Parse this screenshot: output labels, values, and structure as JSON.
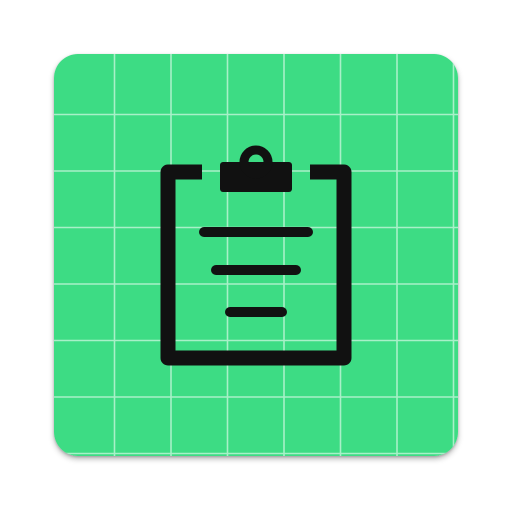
{
  "app_icon": {
    "icon": "clipboard-icon",
    "background_pattern": "grid",
    "colors": {
      "background": "#3ddc84",
      "grid_lines": "#a8f0c8",
      "glyph": "#111111"
    }
  }
}
